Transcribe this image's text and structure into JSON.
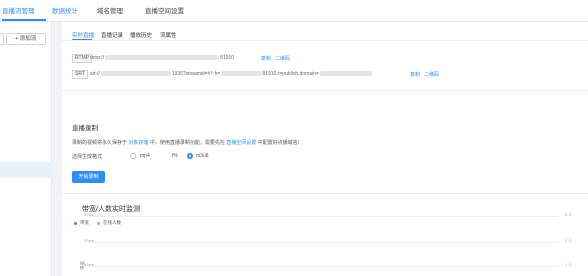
{
  "topbar": {
    "tabs": [
      {
        "label": "直播流管理"
      },
      {
        "label": "数据统计"
      },
      {
        "label": "域名管理"
      },
      {
        "label": "直播空间设置"
      }
    ]
  },
  "sidebar": {
    "add_button": "+ 添加流"
  },
  "subtabs": [
    "实时直播",
    "直播记录",
    "播放历史",
    "流属性"
  ],
  "streams": [
    {
      "tag": "RTMP",
      "url_start": "rtmp://",
      "url_end": "81910",
      "copy": "复制",
      "qr": "二维码"
    },
    {
      "tag": "SRT",
      "url_start": "srt://",
      "url_mid": "1935?streamid=#!::h=",
      "url_mid2": "81910,r=publish,domain=",
      "copy": "复制",
      "qr": "二维码"
    }
  ],
  "recording": {
    "title": "直播录制",
    "desc_before": "录制的视频将永久保存于",
    "desc_link1": "对象存储",
    "desc_mid": "中。使用直播录制功能，需要先在",
    "desc_link2": "直播空间设置",
    "desc_after": "中配置好点播域名!",
    "format_label": "选择生成格式",
    "option1": "mp4",
    "option1_suffix": "f%",
    "option2": "m3u8",
    "selected": "m3u8",
    "start_button": "开始录制"
  },
  "chart": {
    "title": "带宽/人数实时监测",
    "legend": [
      {
        "name": "带宽",
        "color": "#2f8ef5"
      },
      {
        "name": "在线人数",
        "color": "#5ad0c8"
      }
    ],
    "y_ticks": [
      "3 bps",
      "2 bps",
      "1 bps"
    ],
    "right_ticks": [
      "3 人",
      "2 人",
      "1 人"
    ],
    "ylabel": "带宽"
  }
}
